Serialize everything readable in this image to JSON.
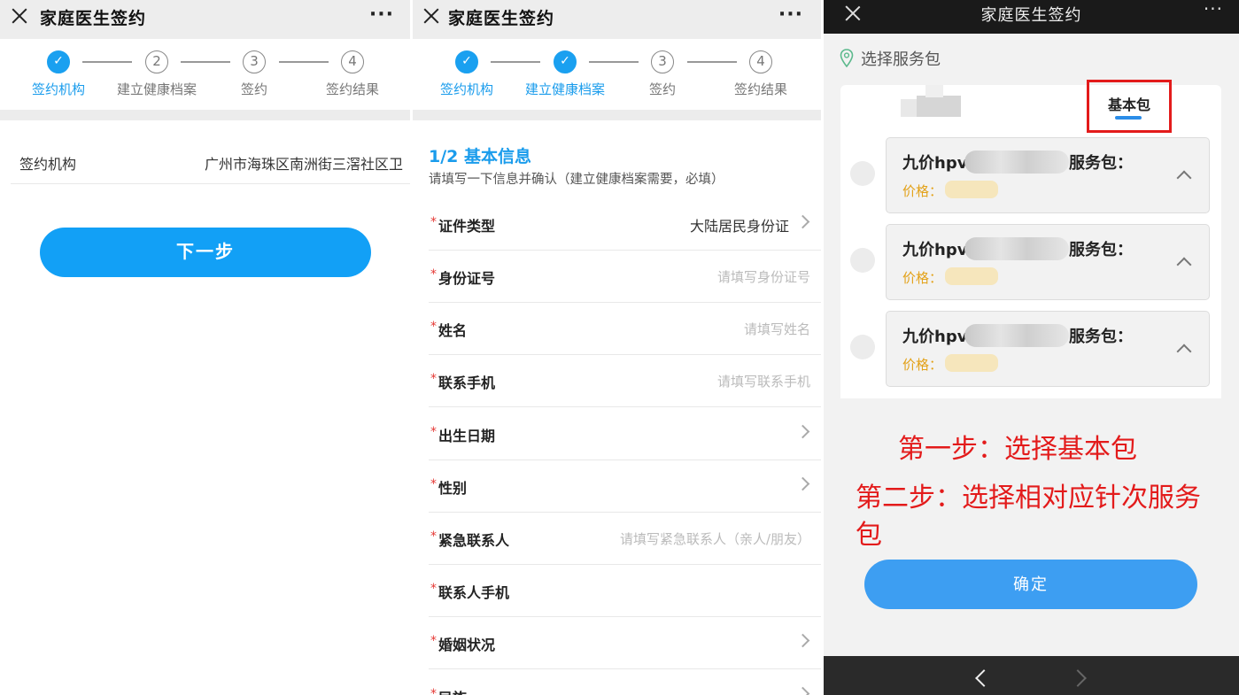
{
  "app_title": "家庭医生签约",
  "more_glyph": "···",
  "steps": [
    {
      "num": "1",
      "label": "签约机构"
    },
    {
      "num": "2",
      "label": "建立健康档案"
    },
    {
      "num": "3",
      "label": "签约"
    },
    {
      "num": "4",
      "label": "签约结果"
    }
  ],
  "check_glyph": "✓",
  "panel1": {
    "org_label": "签约机构",
    "org_value": "广州市海珠区南洲街三滘社区卫",
    "next_button": "下一步"
  },
  "panel2": {
    "form_title": "1/2 基本信息",
    "form_subtitle": "请填写一下信息并确认（建立健康档案需要，必填）",
    "required_mark": "*",
    "fields": [
      {
        "label": "证件类型",
        "value": "大陆居民身份证",
        "placeholder": ""
      },
      {
        "label": "身份证号",
        "value": "",
        "placeholder": "请填写身份证号"
      },
      {
        "label": "姓名",
        "value": "",
        "placeholder": "请填写姓名"
      },
      {
        "label": "联系手机",
        "value": "",
        "placeholder": "请填写联系手机"
      },
      {
        "label": "出生日期",
        "value": "",
        "placeholder": ""
      },
      {
        "label": "性别",
        "value": "",
        "placeholder": ""
      },
      {
        "label": "紧急联系人",
        "value": "",
        "placeholder": "请填写紧急联系人（亲人/朋友）"
      },
      {
        "label": "联系人手机",
        "value": "",
        "placeholder": ""
      },
      {
        "label": "婚姻状况",
        "value": "",
        "placeholder": ""
      },
      {
        "label": "民族",
        "value": "",
        "placeholder": ""
      }
    ]
  },
  "panel3": {
    "section_title": "选择服务包",
    "tab_selected": "基本包",
    "packages": [
      {
        "name_prefix": "九价hpv",
        "name_suffix": "服务包：",
        "price_label": "价格："
      },
      {
        "name_prefix": "九价hpv",
        "name_suffix": "服务包：",
        "price_label": "价格："
      },
      {
        "name_prefix": "九价hpv",
        "name_suffix": "服务包：",
        "price_label": "价格："
      }
    ],
    "annotation_step1": "第一步：选择基本包",
    "annotation_step2": "第二步：选择相对应针次服务包",
    "confirm_button": "确定"
  },
  "colors": {
    "accent_blue": "#12a0f6",
    "annotation_red": "#e31b1b",
    "price_orange": "#e3a21a"
  }
}
